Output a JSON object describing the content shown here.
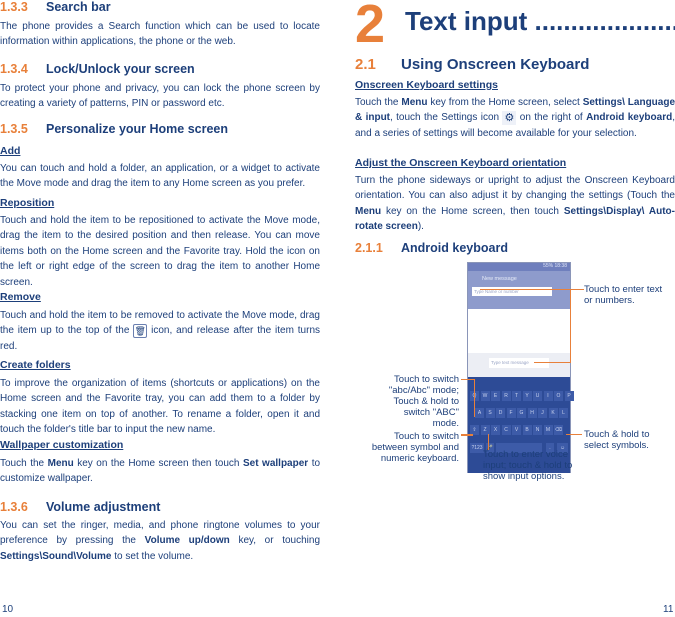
{
  "left": {
    "s133": {
      "num": "1.3.3",
      "title": "Search bar",
      "text": "The phone provides a Search function which can be used to locate information within applications, the phone or the web."
    },
    "s134": {
      "num": "1.3.4",
      "title": "Lock/Unlock your screen",
      "text": "To protect your phone and privacy, you can lock the phone screen by creating a variety of patterns, PIN or password etc."
    },
    "s135": {
      "num": "1.3.5",
      "title": "Personalize your Home screen"
    },
    "add": {
      "title": "Add",
      "text": "You can touch and hold a folder, an application, or a widget to activate the Move mode and drag the item to any Home screen as you prefer."
    },
    "reposition": {
      "title": "Reposition",
      "text": "Touch and hold the item to be repositioned to activate the Move mode, drag the item to the desired position and then release. You can move items both on the Home screen and the Favorite tray. Hold the icon on the left or right edge of the screen to drag the item to another Home screen."
    },
    "remove": {
      "title": "Remove",
      "text1": "Touch and hold the item to be removed to activate the Move mode, drag the item up to the top of the",
      "text2": "icon, and release after the item turns red."
    },
    "folders": {
      "title": "Create folders",
      "text": "To improve the organization of items (shortcuts or applications) on the Home screen and the Favorite tray, you can add them to a folder by stacking one item on top of another. To rename a folder, open it and touch the folder's title bar to input the new name."
    },
    "wallpaper": {
      "title": "Wallpaper customization",
      "t1": "Touch the",
      "b1": "Menu",
      "t2": "key on the Home screen then touch",
      "b2": "Set wallpaper",
      "t3": "to customize wallpaper."
    },
    "s136": {
      "num": "1.3.6",
      "title": "Volume adjustment",
      "t1": "You can set the ringer, media, and phone ringtone volumes to your preference by pressing the",
      "b1": "Volume up/down",
      "t2": "key, or touching",
      "b2": "Settings\\Sound\\Volume",
      "t3": "to set the volume."
    },
    "page": "10"
  },
  "right": {
    "chapter_num": "2",
    "chapter_title": "Text input ....................",
    "s21": {
      "num": "2.1",
      "title": "Using Onscreen Keyboard"
    },
    "settings": {
      "title": "Onscreen Keyboard settings",
      "t1": "Touch the",
      "b1": "Menu",
      "t2": "key from the Home screen, select",
      "b2": "Settings\\ Language & input",
      "t3": ", touch the Settings icon",
      "t4": "on the right of",
      "b3": "Android keyboard",
      "t5": ", and a series of settings will become available for your selection."
    },
    "orient": {
      "title": "Adjust the Onscreen Keyboard orientation",
      "t1": "Turn the phone sideways or upright to adjust the Onscreen Keyboard orientation. You can also adjust it by changing the settings (Touch the",
      "b1": "Menu",
      "t2": "key on the Home screen, then touch",
      "b2": "Settings\\Display\\ Auto-rotate screen",
      "t3": ")."
    },
    "s211": {
      "num": "2.1.1",
      "title": "Android keyboard"
    },
    "phone": {
      "status": "55% 18:38",
      "header": "New message",
      "to_placeholder": "Type Name or number",
      "msg_placeholder": "Type text message",
      "rows": [
        [
          "Q",
          "W",
          "E",
          "R",
          "T",
          "Y",
          "U",
          "I",
          "O",
          "P"
        ],
        [
          "A",
          "S",
          "D",
          "F",
          "G",
          "H",
          "J",
          "K",
          "L"
        ],
        [
          "⇧",
          "Z",
          "X",
          "C",
          "V",
          "B",
          "N",
          "M",
          "⌫"
        ]
      ],
      "sym_key": "?123"
    },
    "callouts": {
      "enter_text": "Touch to enter text or numbers.",
      "switch_mode": "Touch to switch \"abc/Abc\" mode; Touch & hold to switch \"ABC\" mode.",
      "switch_symbol": "Touch to switch between symbol and numeric keyboard.",
      "voice": "Touch to enter voice input; touch & hold to show input options.",
      "symbols": "Touch & hold to select symbols."
    },
    "page": "11"
  },
  "colors": {
    "heading": "#1d3f7a",
    "accent": "#e8803a"
  }
}
